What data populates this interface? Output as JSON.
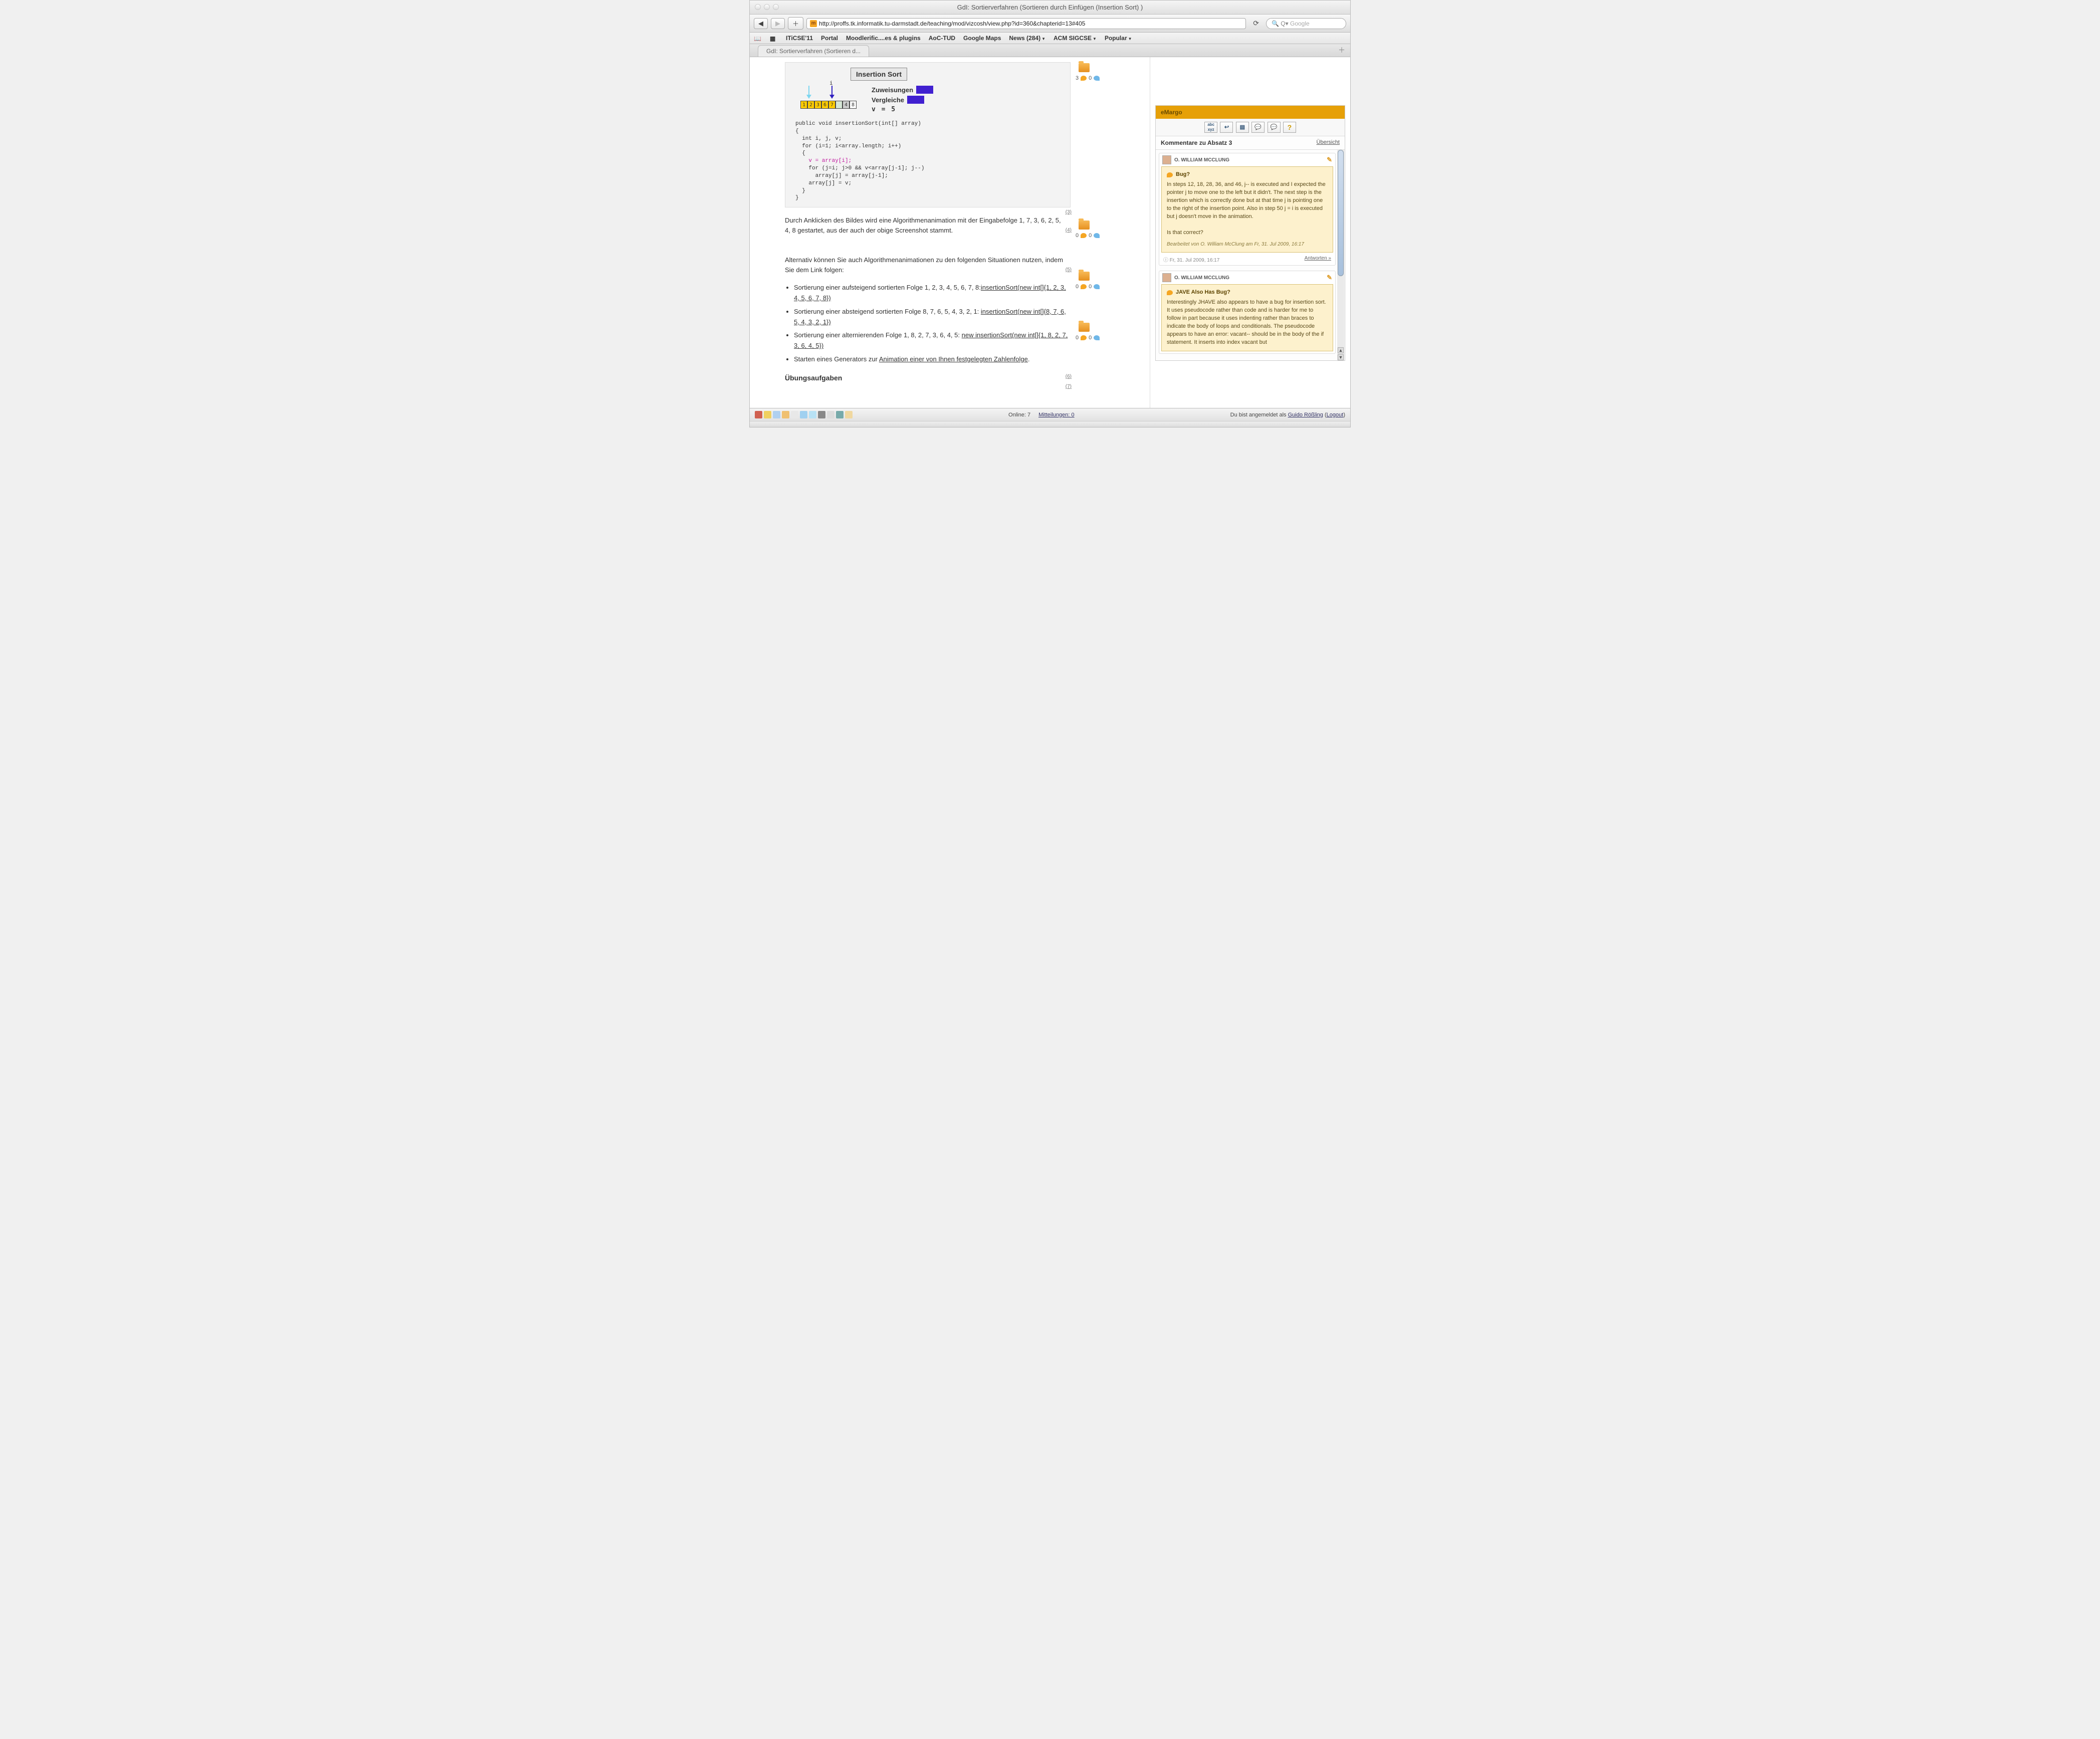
{
  "window": {
    "title": "GdI: Sortierverfahren (Sortieren durch Einfügen (Insertion Sort) )"
  },
  "nav": {
    "url": "http://proffs.tk.informatik.tu-darmstadt.de/teaching/mod/vizcosh/view.php?id=360&chapterid=13#405"
  },
  "search": {
    "placeholder": "Google",
    "prefix": "Q▾"
  },
  "bookmarks": {
    "iti": "ITiCSE'11",
    "portal": "Portal",
    "moodle": "Moodlerific....es & plugins",
    "aoc": "AoC-TUD",
    "gmaps": "Google Maps",
    "news": "News (284)",
    "sigcse": "ACM SIGCSE",
    "popular": "Popular"
  },
  "tab": {
    "label": "GdI: Sortierverfahren (Sortieren d..."
  },
  "algo": {
    "title": "Insertion Sort",
    "i_label": "i",
    "cells": [
      "1",
      "2",
      "3",
      "6",
      "7",
      "",
      "4",
      "8"
    ],
    "legend1": "Zuweisungen",
    "legend2": "Vergleiche",
    "vline": "v = 5",
    "code_pre": "public void insertionSort(int[] array)\n{\n  int i, j, v;\n  for (i=1; i<array.length; i++)\n  {\n",
    "code_hl": "    v = array[i];",
    "code_post": "\n    for (j=i; j>0 && v<array[j-1]; j--)\n      array[j] = array[j-1];\n    array[j] = v;\n  }\n}"
  },
  "paras": {
    "p3": "(3)",
    "p4_text": "Durch Anklicken des Bildes wird eine Algorithmenanimation mit der Eingabefolge 1, 7, 3, 6, 2, 5, 4, 8 gestartet, aus der auch der obige Screenshot stammt.",
    "p4": "(4)",
    "p5_text": "Alternativ können Sie auch Algorithmenanimationen zu den folgenden Situationen nutzen, indem Sie dem Link folgen:",
    "p5": "(5)",
    "p6": "(6)",
    "p7": "(7)"
  },
  "list": {
    "li1_a": "Sortierung einer aufsteigend sortierten Folge 1, 2, 3, 4, 5, 6, 7, 8:",
    "li1_b": "insertionSort(new int[]{1, 2, 3, 4, 5, 6, 7, 8})",
    "li2_a": "Sortierung einer absteigend sortierten Folge 8, 7, 6, 5, 4, 3, 2, 1: ",
    "li2_b": "insertionSort(new int[]{8, 7, 6, 5, 4, 3, 2, 1})",
    "li3_a": "Sortierung einer alternierenden Folge 1, 8, 2, 7, 3, 6, 4, 5: ",
    "li3_b": "new insertionSort(new int[]{1, 8, 2, 7, 3, 6, 4, 5})",
    "li4_a": "Starten eines Generators zur ",
    "li4_b": "Animation einer von Ihnen festgelegten Zahlenfolge",
    "li4_c": "."
  },
  "section": {
    "h": "Übungsaufgaben"
  },
  "margins": {
    "b1": {
      "c1": "3",
      "c2": "0"
    },
    "rest": {
      "c1": "0",
      "c2": "0"
    }
  },
  "emargo": {
    "title": "eMargo",
    "icons": {
      "abc": "abc",
      "reply": "↩",
      "page": "▤",
      "c1": "💬",
      "c2": "💬",
      "help": "?"
    },
    "sub": "Kommentare zu Absatz 3",
    "overview": "Übersicht",
    "c1": {
      "author": "O. WILLIAM MCCLUNG",
      "title": "Bug?",
      "body": "In steps 12, 18, 28, 36, and 46, j-- is executed and I expected the pointer j to move one to the left but it didn't. The next step is the insertion which is correctly done but at that time j is pointing one to the right of the insertion point. Also in step 50 j = i is executed but j doesn't move in the animation.",
      "q": "Is that correct?",
      "edited": "Bearbeitet von O. William McClung am Fr, 31. Jul 2009, 16:17",
      "date": "Fr, 31. Jul 2009, 16:17",
      "reply": "Antworten »"
    },
    "c2": {
      "author": "O. WILLIAM MCCLUNG",
      "title": "JAVE Also Has Bug?",
      "body": "Interestingly JHAVE also appears to have a bug for insertion sort. It uses pseudocode rather than code and is harder for me to follow in part because it uses indenting rather than braces to indicate the body of loops and conditionals. The pseudocode appears to have an error: vacant-- should be in the body of the if statement. It inserts into index vacant but"
    }
  },
  "status": {
    "online": "Online: 7",
    "msgs": "Mitteilungen: 0",
    "right_a": "Du bist angemeldet als ",
    "right_b": "Guido Rößling",
    "right_c": " (",
    "right_d": "Logout",
    "right_e": ")"
  }
}
